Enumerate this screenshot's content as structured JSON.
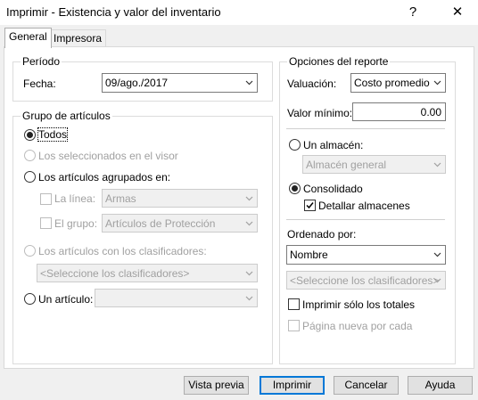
{
  "window": {
    "title": "Imprimir - Existencia y valor del inventario",
    "help": "?",
    "close": "✕"
  },
  "tabs": [
    "General",
    "Impresora"
  ],
  "periodo": {
    "legend": "Período",
    "fecha_label": "Fecha:",
    "fecha_value": "09/ago./2017"
  },
  "grupo": {
    "legend": "Grupo de artículos",
    "todos": "Todos",
    "seleccionados": "Los seleccionados en el visor",
    "agrupados": "Los artículos agrupados en:",
    "linea_label": "La línea:",
    "linea_value": "Armas",
    "grupo_label": "El grupo:",
    "grupo_value": "Artículos de Protección",
    "clasificadores": "Los artículos con los clasificadores:",
    "clasificadores_value": "<Seleccione los clasificadores>",
    "articulo": "Un artículo:",
    "articulo_value": ""
  },
  "opciones": {
    "legend": "Opciones del reporte",
    "valuacion_label": "Valuación:",
    "valuacion_value": "Costo promedio",
    "valor_minimo_label": "Valor mínimo:",
    "valor_minimo_value": "0.00",
    "un_almacen": "Un almacén:",
    "almacen_value": "Almacén general",
    "consolidado": "Consolidado",
    "detallar": "Detallar almacenes",
    "ordenado_label": "Ordenado por:",
    "ordenado_value": "Nombre",
    "clasificadores_value": "<Seleccione los clasificadores>",
    "solo_totales": "Imprimir sólo los totales",
    "pagina_nueva": "Página nueva por cada"
  },
  "buttons": {
    "vista_previa": "Vista previa",
    "imprimir": "Imprimir",
    "cancelar": "Cancelar",
    "ayuda": "Ayuda"
  }
}
